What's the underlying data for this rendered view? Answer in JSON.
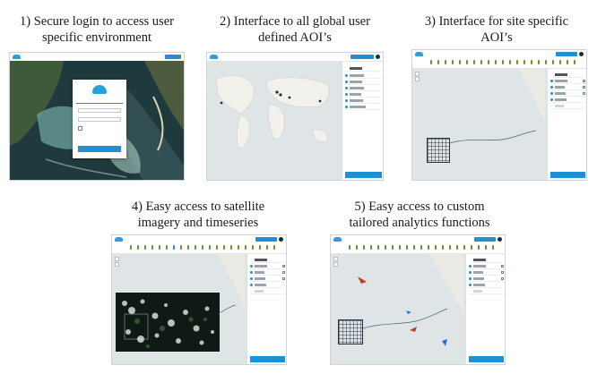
{
  "captions": [
    {
      "id": "login",
      "line1": "1) Secure login to access user",
      "line2": "specific environment"
    },
    {
      "id": "global",
      "line1": "2) Interface to all global user",
      "line2": "defined AOI’s"
    },
    {
      "id": "site",
      "line1": "3) Interface for site specific",
      "line2": "AOI’s"
    },
    {
      "id": "imagery",
      "line1": "4) Easy access to satellite",
      "line2": "imagery and timeseries"
    },
    {
      "id": "analytics",
      "line1": "5) Easy access to custom",
      "line2": "tailored analytics functions"
    }
  ],
  "colors": {
    "accent_blue": "#1e90d6",
    "map_grey": "#dfe4e6",
    "land_beige": "#eceae4",
    "timeline_green": "#6b8e23",
    "marker_red": "#c0392b",
    "sea_dark": "#1f3a3c"
  },
  "icons": [
    "logo-icon",
    "avatar-icon",
    "zoom-in-icon",
    "zoom-out-icon",
    "checkbox-icon",
    "marker-icon",
    "layer-dot-icon"
  ]
}
